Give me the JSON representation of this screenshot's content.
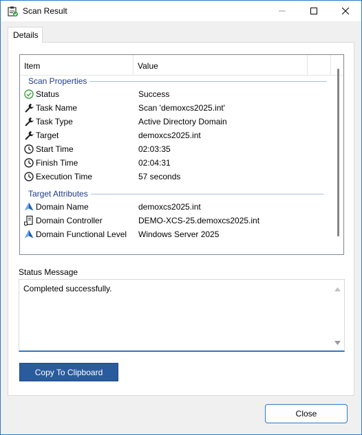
{
  "window": {
    "title": "Scan Result",
    "icon": "scan-result-icon"
  },
  "tabs": [
    {
      "label": "Details",
      "selected": true
    }
  ],
  "grid": {
    "columns": [
      "Item",
      "Value"
    ],
    "groups": [
      {
        "title": "Scan Properties",
        "rows": [
          {
            "icon": "check-circle-icon",
            "label": "Status",
            "value": "Success"
          },
          {
            "icon": "wrench-icon",
            "label": "Task Name",
            "value": "Scan 'demoxcs2025.int'"
          },
          {
            "icon": "wrench-icon",
            "label": "Task Type",
            "value": "Active Directory Domain"
          },
          {
            "icon": "wrench-icon",
            "label": "Target",
            "value": "demoxcs2025.int"
          },
          {
            "icon": "clock-icon",
            "label": "Start Time",
            "value": "02:03:35"
          },
          {
            "icon": "clock-icon",
            "label": "Finish Time",
            "value": "02:04:31"
          },
          {
            "icon": "clock-icon",
            "label": "Execution Time",
            "value": "57 seconds"
          }
        ]
      },
      {
        "title": "Target Attributes",
        "rows": [
          {
            "icon": "domain-icon",
            "label": "Domain Name",
            "value": "demoxcs2025.int"
          },
          {
            "icon": "server-icon",
            "label": "Domain Controller",
            "value": "DEMO-XCS-25.demoxcs2025.int"
          },
          {
            "icon": "domain-icon",
            "label": "Domain Functional Level",
            "value": "Windows Server 2025"
          }
        ]
      }
    ]
  },
  "status": {
    "label": "Status Message",
    "message": "Completed successfully."
  },
  "buttons": {
    "copy": "Copy To Clipboard",
    "close": "Close"
  },
  "colors": {
    "accent": "#2b78c6",
    "copy_button": "#2a5b9c",
    "group_title": "#1c3b8f",
    "success": "#3aa13a"
  }
}
